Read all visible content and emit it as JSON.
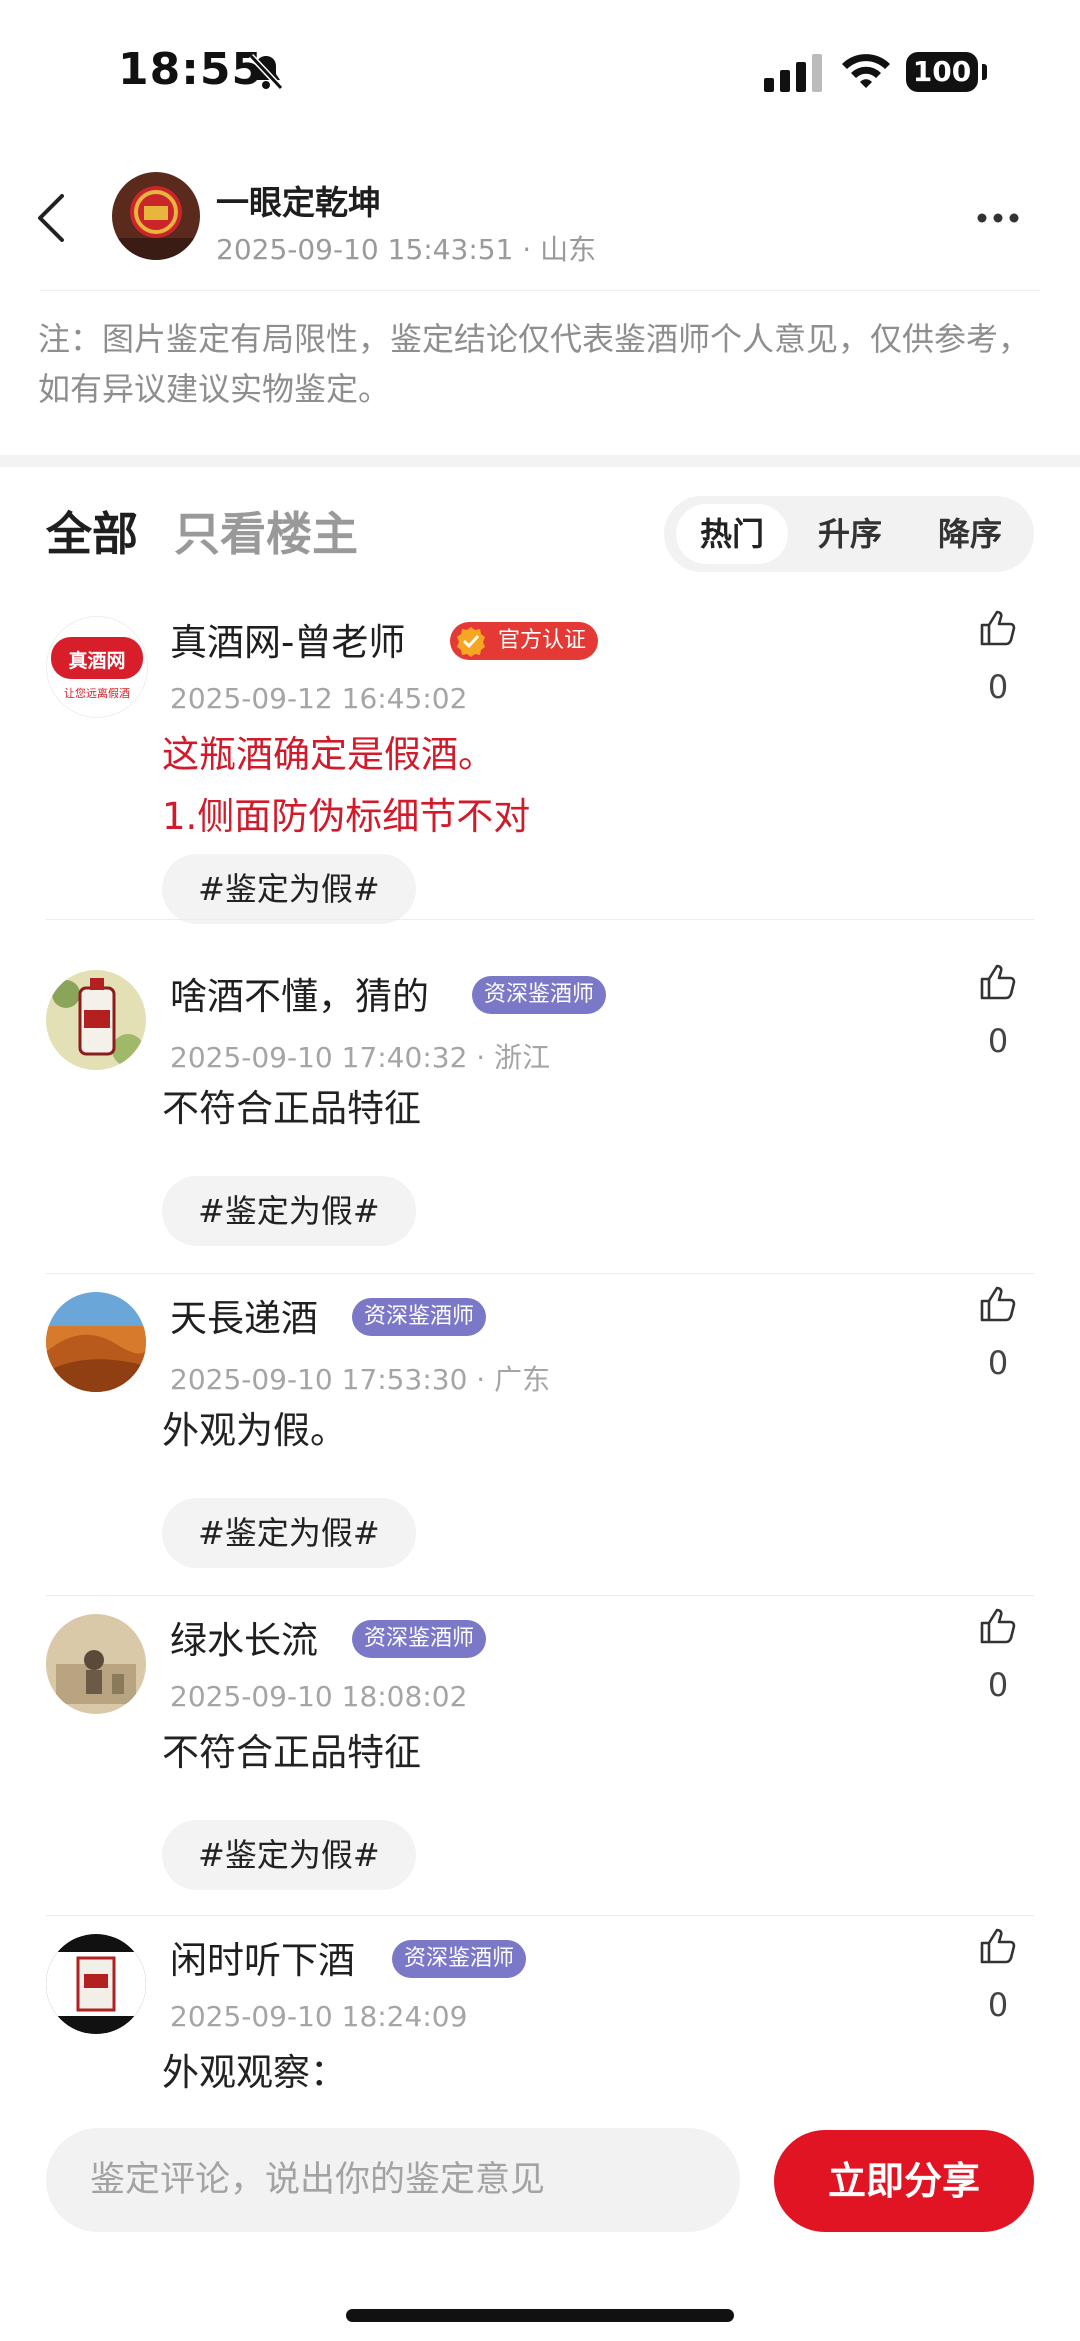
{
  "status_bar": {
    "time": "18:55",
    "battery": "100"
  },
  "header": {
    "title": "一眼定乾坤",
    "meta": "2025-09-10 15:43:51 · 山东"
  },
  "notice": "注：图片鉴定有局限性，鉴定结论仅代表鉴酒师个人意见，仅供参考，如有异议建议实物鉴定。",
  "filters": {
    "all": "全部",
    "owner_only": "只看楼主"
  },
  "sort": {
    "hot": "热门",
    "asc": "升序",
    "desc": "降序",
    "active": "hot"
  },
  "comments": [
    {
      "name": "真酒网-曾老师",
      "badge": "官方认证",
      "avatar_text": "真酒网",
      "avatar_subtext": "让您远离假酒",
      "time": "2025-09-12 16:45:02",
      "lines": [
        "这瓶酒确定是假酒。",
        "1.侧面防伪标细节不对"
      ],
      "tag": "#鉴定为假#",
      "likes": "0"
    },
    {
      "name": "啥酒不懂，猜的",
      "badge": "资深鉴酒师",
      "time": "2025-09-10 17:40:32 · 浙江",
      "lines": [
        "不符合正品特征"
      ],
      "tag": "#鉴定为假#",
      "likes": "0"
    },
    {
      "name": "天長递酒",
      "badge": "资深鉴酒师",
      "time": "2025-09-10 17:53:30 · 广东",
      "lines": [
        "外观为假。"
      ],
      "tag": "#鉴定为假#",
      "likes": "0"
    },
    {
      "name": "绿水长流",
      "badge": "资深鉴酒师",
      "time": "2025-09-10 18:08:02",
      "lines": [
        "不符合正品特征"
      ],
      "tag": "#鉴定为假#",
      "likes": "0"
    },
    {
      "name": "闲时听下酒",
      "badge": "资深鉴酒师",
      "time": "2025-09-10 18:24:09",
      "lines": [
        "外观观察："
      ],
      "likes": "0"
    }
  ],
  "bottom_bar": {
    "input_placeholder": "鉴定评论，说出你的鉴定意见",
    "share_label": "立即分享"
  },
  "colors": {
    "accent": "#e01423",
    "expert_badge": "#7b78c8",
    "official_badge": "#e53935"
  }
}
